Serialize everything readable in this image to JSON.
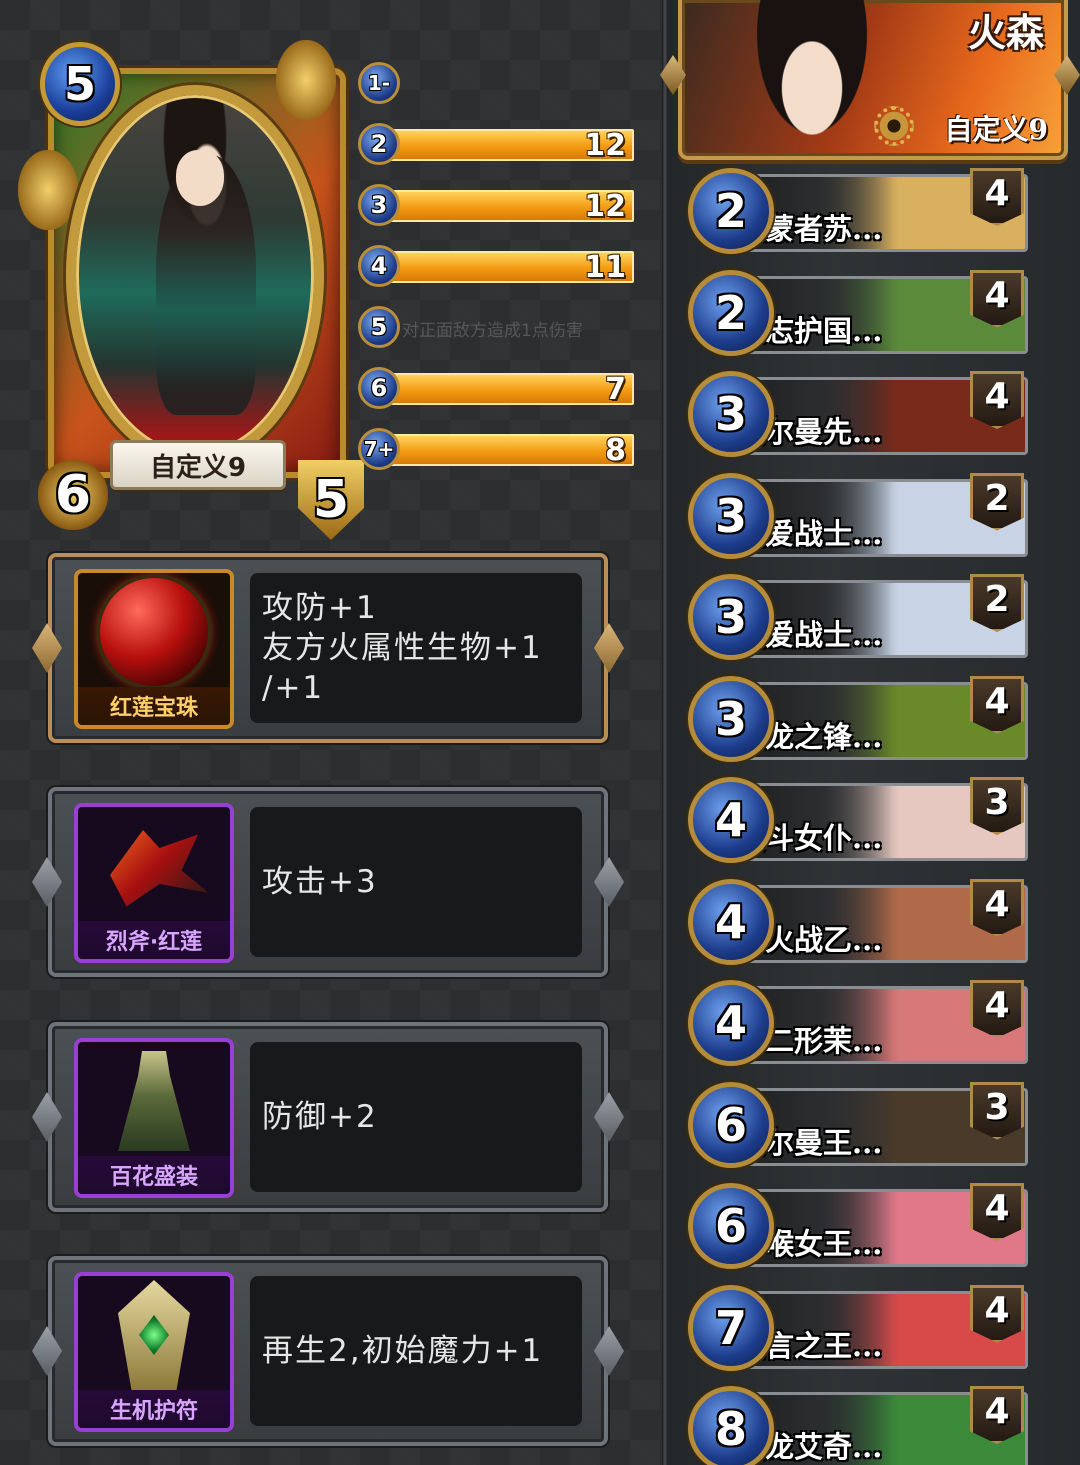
{
  "hero": {
    "name": "自定义9",
    "cost": "5",
    "attack": "6",
    "health": "5"
  },
  "mana_curve": [
    {
      "cost": "1",
      "plus": "-",
      "count": "",
      "fill_fraction": 0.0,
      "note": ""
    },
    {
      "cost": "2",
      "plus": "",
      "count": "12",
      "fill_fraction": 1.0,
      "note": ""
    },
    {
      "cost": "3",
      "plus": "",
      "count": "12",
      "fill_fraction": 1.0,
      "note": ""
    },
    {
      "cost": "4",
      "plus": "",
      "count": "11",
      "fill_fraction": 1.0,
      "note": ""
    },
    {
      "cost": "5",
      "plus": "",
      "count": "",
      "fill_fraction": 0.0,
      "note": "对正面敌方造成1点伤害"
    },
    {
      "cost": "6",
      "plus": "",
      "count": "7",
      "fill_fraction": 1.0,
      "note": ""
    },
    {
      "cost": "7",
      "plus": "+",
      "count": "8",
      "fill_fraction": 1.0,
      "note": ""
    }
  ],
  "equipment": [
    {
      "name": "红莲宝珠",
      "description": "攻防+1\n友方火属性生物+1\n/+1",
      "icon": "red-orb-icon",
      "rarity": "gold"
    },
    {
      "name": "烈斧·红莲",
      "description": "攻击+3",
      "icon": "axe-icon",
      "rarity": "purple"
    },
    {
      "name": "百花盛装",
      "description": "防御+2",
      "icon": "dress-icon",
      "rarity": "purple"
    },
    {
      "name": "生机护符",
      "description": "再生2,初始魔力+1",
      "icon": "amulet-icon",
      "rarity": "purple"
    }
  ],
  "deck": {
    "hero_title": "火森",
    "subtitle": "自定义9",
    "cards": [
      {
        "cost": "2",
        "name": "启蒙者苏...",
        "count": "4",
        "art": "#d8b060"
      },
      {
        "cost": "2",
        "name": "壮志护国...",
        "count": "4",
        "art": "#5a8a3a"
      },
      {
        "cost": "3",
        "name": "凯尔曼先...",
        "count": "4",
        "art": "#7a2a1a"
      },
      {
        "cost": "3",
        "name": "纯爱战士...",
        "count": "2",
        "art": "#c8d4e6"
      },
      {
        "cost": "3",
        "name": "纯爱战士...",
        "count": "2",
        "art": "#c8d4e6"
      },
      {
        "cost": "3",
        "name": "青龙之锋...",
        "count": "4",
        "art": "#6a8a2a"
      },
      {
        "cost": "4",
        "name": "决斗女仆...",
        "count": "3",
        "art": "#e6c8c0"
      },
      {
        "cost": "4",
        "name": "怒火战乙...",
        "count": "4",
        "art": "#b06a4a"
      },
      {
        "cost": "4",
        "name": "第二形茉...",
        "count": "4",
        "art": "#d87878"
      },
      {
        "cost": "6",
        "name": "凯尔曼王...",
        "count": "3",
        "art": "#4a3a2a"
      },
      {
        "cost": "6",
        "name": "千喉女王...",
        "count": "4",
        "art": "#e0788a"
      },
      {
        "cost": "7",
        "name": "谎言之王...",
        "count": "4",
        "art": "#d84a4a"
      },
      {
        "cost": "8",
        "name": "蚀龙艾奇...",
        "count": "4",
        "art": "#3a8a3a"
      }
    ]
  }
}
